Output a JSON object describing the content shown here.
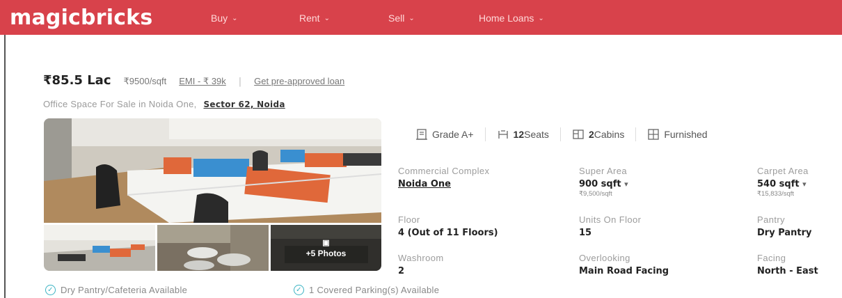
{
  "header": {
    "logo": "magicbricks",
    "nav": [
      {
        "label": "Buy"
      },
      {
        "label": "Rent"
      },
      {
        "label": "Sell"
      },
      {
        "label": "Home Loans"
      }
    ]
  },
  "listing": {
    "price": "₹85.5 Lac",
    "price_per_sqft": "₹9500/sqft",
    "emi": "EMI - ₹ 39k",
    "separator": "|",
    "loan_link": "Get pre-approved loan",
    "subtitle": "Office Space For Sale in Noida One,",
    "location": "Sector 62, Noida"
  },
  "photos": {
    "more_label": "+5 Photos"
  },
  "chips": {
    "grade": "Grade A+",
    "seats_count": "12",
    "seats_label": "Seats",
    "cabins_count": "2",
    "cabins_label": "Cabins",
    "furnished": "Furnished"
  },
  "details": {
    "complex": {
      "label": "Commercial Complex",
      "value": "Noida One"
    },
    "super_area": {
      "label": "Super Area",
      "value": "900 sqft",
      "sub": "₹9,500/sqft"
    },
    "carpet_area": {
      "label": "Carpet Area",
      "value": "540 sqft",
      "sub": "₹15,833/sqft"
    },
    "floor": {
      "label": "Floor",
      "value": "4 (Out of 11 Floors)"
    },
    "units": {
      "label": "Units On Floor",
      "value": "15"
    },
    "pantry": {
      "label": "Pantry",
      "value": "Dry Pantry"
    },
    "washroom": {
      "label": "Washroom",
      "value": "2"
    },
    "overlooking": {
      "label": "Overlooking",
      "value": "Main Road Facing"
    },
    "facing": {
      "label": "Facing",
      "value": "North - East"
    }
  },
  "amenities": [
    {
      "label": "Dry Pantry/Cafeteria Available"
    },
    {
      "label": "1 Covered Parking(s) Available"
    }
  ],
  "colors": {
    "brand": "#d8424b",
    "accent_check": "#3bb3c3"
  }
}
